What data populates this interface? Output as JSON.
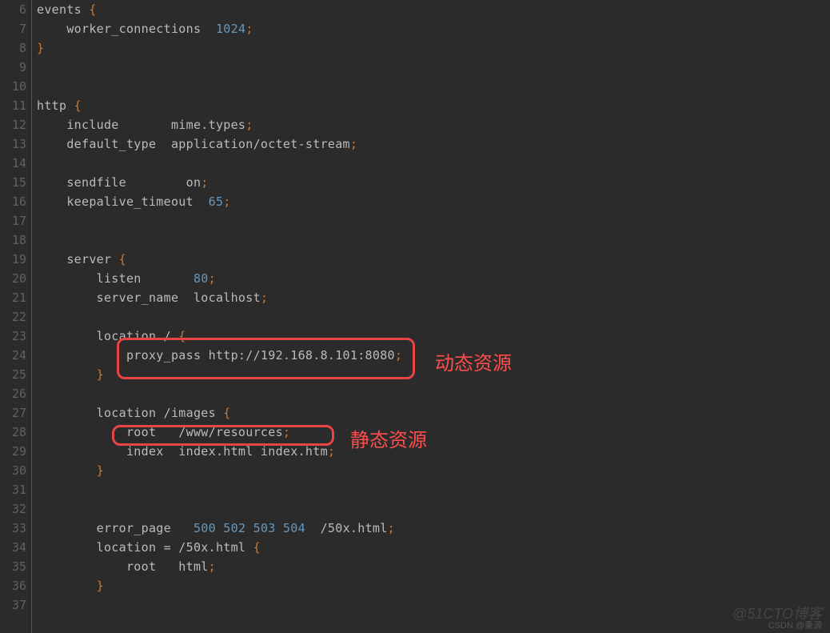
{
  "gutter": [
    "6",
    "7",
    "8",
    "9",
    "10",
    "11",
    "12",
    "13",
    "14",
    "15",
    "16",
    "17",
    "18",
    "19",
    "20",
    "21",
    "22",
    "23",
    "24",
    "25",
    "26",
    "27",
    "28",
    "29",
    "30",
    "31",
    "32",
    "33",
    "34",
    "35",
    "36",
    "37"
  ],
  "lines": {
    "l6a": "events ",
    "l6b": "{",
    "l7a": "    worker_connections  ",
    "l7n": "1024",
    "l7p": ";",
    "l8a": "",
    "l8p": "}",
    "l9": "",
    "l10": "",
    "l11a": "http ",
    "l11b": "{",
    "l12a": "    include       mime.types",
    "l12p": ";",
    "l13a": "    default_type  application/octet-stream",
    "l13p": ";",
    "l14": "",
    "l15a": "    sendfile        on",
    "l15p": ";",
    "l16a": "    keepalive_timeout  ",
    "l16n": "65",
    "l16p": ";",
    "l17": "",
    "l18": "",
    "l19a": "    server ",
    "l19b": "{",
    "l20a": "        listen       ",
    "l20n": "80",
    "l20p": ";",
    "l21a": "        server_name  localhost",
    "l21p": ";",
    "l22": "",
    "l23a": "        location / ",
    "l23b": "{",
    "l24a": "            proxy_pass http://192.168.8.101:8080",
    "l24p": ";",
    "l25a": "        ",
    "l25p": "}",
    "l26": "",
    "l27a": "        location /images ",
    "l27b": "{",
    "l28a": "            root   /www/resources",
    "l28p": ";",
    "l29a": "            index  index.html index.htm",
    "l29p": ";",
    "l30a": "        ",
    "l30p": "}",
    "l31": "",
    "l32": "",
    "l33a": "        error_page   ",
    "l33n": "500 502 503 504",
    "l33b": "  /50x.html",
    "l33p": ";",
    "l34a": "        location = /50x.html ",
    "l34b": "{",
    "l35a": "            root   html",
    "l35p": ";",
    "l36a": "        ",
    "l36p": "}",
    "l37": ""
  },
  "annotations": {
    "dyn_label": "动态资源",
    "static_label": "静态资源"
  },
  "watermark1": "@51CTO博客",
  "watermark2": "CSDN @秉源"
}
